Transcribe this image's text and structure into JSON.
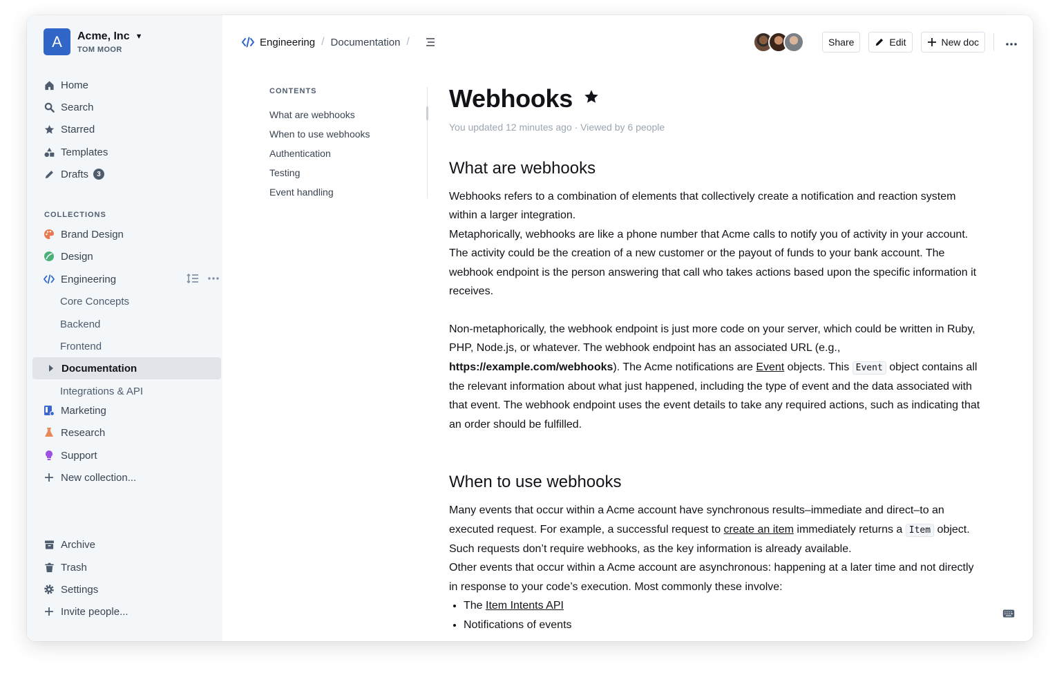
{
  "team": {
    "logo_letter": "A",
    "name": "Acme, Inc",
    "user": "TOM MOOR"
  },
  "nav": {
    "home": "Home",
    "search": "Search",
    "starred": "Starred",
    "templates": "Templates",
    "drafts": "Drafts",
    "drafts_count": "3"
  },
  "collections": {
    "title": "COLLECTIONS",
    "items": [
      {
        "label": "Brand Design",
        "color": "#e5794f"
      },
      {
        "label": "Design",
        "color": "#4cb07b"
      },
      {
        "label": "Engineering",
        "color": "#2f66c8"
      },
      {
        "label": "Marketing",
        "color": "#3b66d1"
      },
      {
        "label": "Research",
        "color": "#e8895a"
      },
      {
        "label": "Support",
        "color": "#9d53e0"
      }
    ],
    "engineering_children": [
      "Core Concepts",
      "Backend",
      "Frontend",
      "Documentation",
      "Integrations & API"
    ],
    "new_collection": "New collection..."
  },
  "footer_nav": {
    "archive": "Archive",
    "trash": "Trash",
    "settings": "Settings",
    "invite": "Invite people..."
  },
  "breadcrumb": {
    "collection": "Engineering",
    "doc": "Documentation"
  },
  "toolbar": {
    "share": "Share",
    "edit": "Edit",
    "new_doc": "New doc"
  },
  "toc": {
    "title": "CONTENTS",
    "items": [
      "What are webhooks",
      "When to use webhooks",
      "Authentication",
      "Testing",
      "Event handling"
    ]
  },
  "doc": {
    "title": "Webhooks",
    "meta": "You updated 12 minutes ago · Viewed by 6 people",
    "h1": "What are webhooks",
    "p1": "Webhooks refers to a combination of elements that collectively create a notification and reaction system within a larger integration.",
    "p2": "Metaphorically, webhooks are like a phone number that Acme calls to notify you of activity in your account. The activity could be the creation of a new customer or the payout of funds to your bank account. The webhook endpoint is the person answering that call who takes actions based upon the specific information it receives.",
    "p3a": "Non-metaphorically, the webhook endpoint is just more code on your server, which could be written in Ruby, PHP, Node.js, or whatever. The webhook endpoint has an associated URL (e.g., ",
    "p3_url": "https://example.com/webhooks",
    "p3b": "). The Acme notifications are ",
    "p3_link": "Event",
    "p3c": " objects. This ",
    "p3_code": "Event",
    "p3d": " object contains all the relevant information about what just happened, including the type of event and the data associated with that event. The webhook endpoint uses the event details to take any required actions, such as indicating that an order should be fulfilled.",
    "h2": "When to use webhooks",
    "p4a": "Many events that occur within a Acme account have synchronous results–immediate and direct–to an executed request. For example, a successful request to ",
    "p4_link": "create an item",
    "p4b": " immediately returns a ",
    "p4_code": "Item",
    "p4c": " object. Such requests don’t require webhooks, as the key information is already available.",
    "p5": "Other events that occur within a Acme account are asynchronous: happening at a later time and not directly in response to your code’s execution. Most commonly these involve:",
    "bullet1_a": "The ",
    "bullet1_link": "Item Intents API",
    "bullet2": "Notifications of events"
  },
  "colors": {
    "accent": "#2f66c8",
    "sidebar_bg": "#f4f7fa",
    "active_bg": "#e1e5ea"
  }
}
